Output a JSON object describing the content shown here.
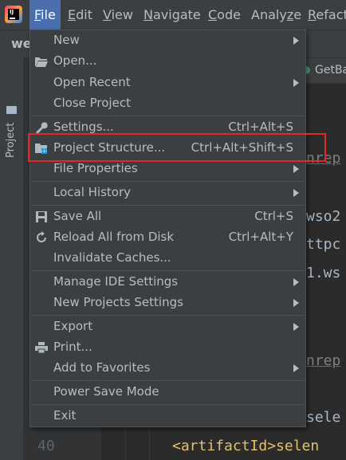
{
  "menubar": {
    "items": [
      {
        "label": "File",
        "mnemonic": "F"
      },
      {
        "label": "Edit",
        "mnemonic": "E"
      },
      {
        "label": "View",
        "mnemonic": "V"
      },
      {
        "label": "Navigate",
        "mnemonic": "N"
      },
      {
        "label": "Code",
        "mnemonic": "C"
      },
      {
        "label": "Analyze",
        "mnemonic": "z"
      },
      {
        "label": "Refacto",
        "mnemonic": "R"
      }
    ]
  },
  "project": {
    "name": "we",
    "toolwindow_label": "Project"
  },
  "editor": {
    "tab_label": "GetBa",
    "line_number": "40",
    "code_fragments": {
      "frag1": "nrep",
      "frag2": "wso2",
      "frag3": "ttpc",
      "frag4": "1.ws",
      "frag5": "nrep",
      "frag6": "sele",
      "frag7": "<artifactId>selen"
    }
  },
  "file_menu": {
    "items": [
      {
        "label": "New",
        "shortcut": "",
        "submenu": true,
        "icon": ""
      },
      {
        "label": "Open...",
        "shortcut": "",
        "submenu": false,
        "icon": "folder-open-icon"
      },
      {
        "label": "Open Recent",
        "shortcut": "",
        "submenu": true,
        "icon": ""
      },
      {
        "label": "Close Project",
        "shortcut": "",
        "submenu": false,
        "icon": ""
      },
      {
        "label": "Settings...",
        "shortcut": "Ctrl+Alt+S",
        "submenu": false,
        "icon": "wrench-icon"
      },
      {
        "label": "Project Structure...",
        "shortcut": "Ctrl+Alt+Shift+S",
        "submenu": false,
        "icon": "project-structure-icon"
      },
      {
        "label": "File Properties",
        "shortcut": "",
        "submenu": true,
        "icon": ""
      },
      {
        "label": "Local History",
        "shortcut": "",
        "submenu": true,
        "icon": ""
      },
      {
        "label": "Save All",
        "shortcut": "Ctrl+S",
        "submenu": false,
        "icon": "save-icon"
      },
      {
        "label": "Reload All from Disk",
        "shortcut": "Ctrl+Alt+Y",
        "submenu": false,
        "icon": "reload-icon"
      },
      {
        "label": "Invalidate Caches...",
        "shortcut": "",
        "submenu": false,
        "icon": ""
      },
      {
        "label": "Manage IDE Settings",
        "shortcut": "",
        "submenu": true,
        "icon": ""
      },
      {
        "label": "New Projects Settings",
        "shortcut": "",
        "submenu": true,
        "icon": ""
      },
      {
        "label": "Export",
        "shortcut": "",
        "submenu": true,
        "icon": ""
      },
      {
        "label": "Print...",
        "shortcut": "",
        "submenu": false,
        "icon": "print-icon"
      },
      {
        "label": "Add to Favorites",
        "shortcut": "",
        "submenu": true,
        "icon": ""
      },
      {
        "label": "Power Save Mode",
        "shortcut": "",
        "submenu": false,
        "icon": ""
      },
      {
        "label": "Exit",
        "shortcut": "",
        "submenu": false,
        "icon": ""
      }
    ]
  },
  "colors": {
    "menu_bg": "#3c3f41",
    "active_menu": "#4b6eaf",
    "highlight_border": "#e0272a",
    "text": "#bbbbbb"
  }
}
